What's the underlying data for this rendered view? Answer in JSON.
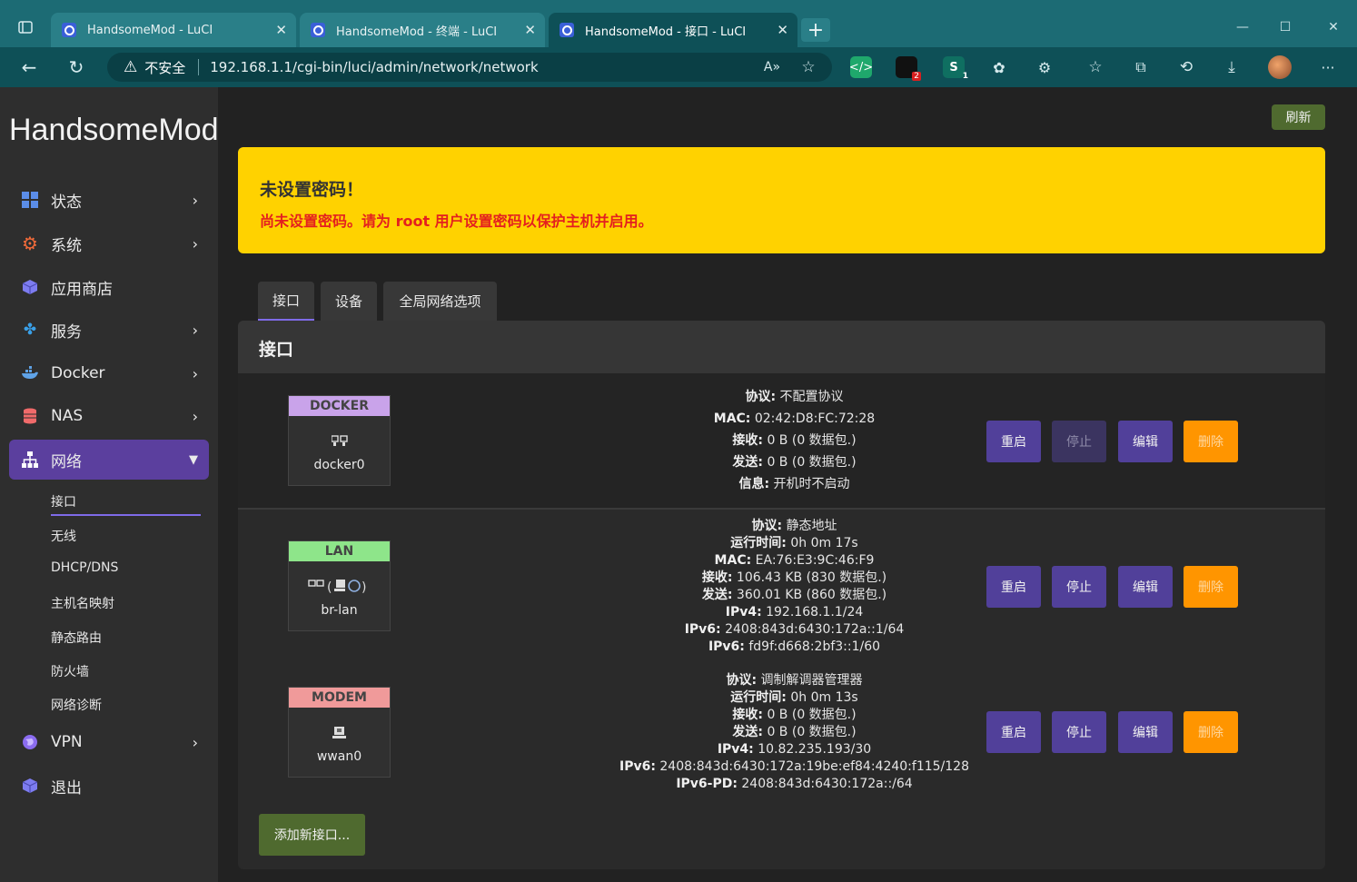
{
  "browser": {
    "tabs": [
      {
        "title": "HandsomeMod - LuCI"
      },
      {
        "title": "HandsomeMod - 终端 - LuCI"
      },
      {
        "title": "HandsomeMod - 接口 - LuCI"
      }
    ],
    "insecure_label": "不安全",
    "url": "192.168.1.1/cgi-bin/luci/admin/network/network",
    "ext_badge_1": "2",
    "ext_badge_2": "1",
    "accent": "#1c6b74"
  },
  "sidebar": {
    "brand": "HandsomeMod",
    "items": [
      {
        "label": "状态",
        "icon": "dashboard-icon"
      },
      {
        "label": "系统",
        "icon": "gear-icon"
      },
      {
        "label": "应用商店",
        "icon": "box-icon"
      },
      {
        "label": "服务",
        "icon": "puzzle-icon"
      },
      {
        "label": "Docker",
        "icon": "docker-icon"
      },
      {
        "label": "NAS",
        "icon": "database-icon"
      },
      {
        "label": "网络",
        "icon": "network-icon"
      },
      {
        "label": "VPN",
        "icon": "globe-icon"
      },
      {
        "label": "退出",
        "icon": "box-icon"
      }
    ],
    "sub_items": [
      "接口",
      "无线",
      "DHCP/DNS",
      "主机名映射",
      "静态路由",
      "防火墙",
      "网络诊断"
    ]
  },
  "main": {
    "refresh_label": "刷新",
    "alert": {
      "title": "未设置密码！",
      "text": "尚未设置密码。请为 root 用户设置密码以保护主机并启用。"
    },
    "tabs": [
      "接口",
      "设备",
      "全局网络选项"
    ],
    "panel_title": "接口",
    "actions": {
      "restart": "重启",
      "stop": "停止",
      "edit": "编辑",
      "delete": "删除"
    },
    "add_label": "添加新接口...",
    "interfaces": [
      {
        "name": "DOCKER",
        "color": "#c9a3ea",
        "device": "docker0",
        "icon": "ethernet-icon",
        "info": [
          {
            "k": "协议:",
            "v": " 不配置协议"
          },
          {
            "k": "MAC:",
            "v": " 02:42:D8:FC:72:28"
          },
          {
            "k": "接收:",
            "v": " 0 B (0 数据包.)"
          },
          {
            "k": "发送:",
            "v": " 0 B (0 数据包.)"
          },
          {
            "k": "信息:",
            "v": " 开机时不启动"
          }
        ]
      },
      {
        "name": "LAN",
        "color": "#8ee58a",
        "device": "br-lan",
        "icon": "bridge-icon",
        "info": [
          {
            "k": "协议:",
            "v": " 静态地址"
          },
          {
            "k": "运行时间:",
            "v": " 0h 0m 17s"
          },
          {
            "k": "MAC:",
            "v": " EA:76:E3:9C:46:F9"
          },
          {
            "k": "接收:",
            "v": " 106.43 KB (830 数据包.)"
          },
          {
            "k": "发送:",
            "v": " 360.01 KB (860 数据包.)"
          },
          {
            "k": "IPv4:",
            "v": " 192.168.1.1/24"
          },
          {
            "k": "IPv6:",
            "v": " 2408:843d:6430:172a::1/64"
          },
          {
            "k": "IPv6:",
            "v": " fd9f:d668:2bf3::1/60"
          }
        ]
      },
      {
        "name": "MODEM",
        "color": "#f09a9a",
        "device": "wwan0",
        "icon": "modem-icon",
        "info": [
          {
            "k": "协议:",
            "v": " 调制解调器管理器"
          },
          {
            "k": "运行时间:",
            "v": " 0h 0m 13s"
          },
          {
            "k": "接收:",
            "v": " 0 B (0 数据包.)"
          },
          {
            "k": "发送:",
            "v": " 0 B (0 数据包.)"
          },
          {
            "k": "IPv4:",
            "v": " 10.82.235.193/30"
          },
          {
            "k": "IPv6:",
            "v": " 2408:843d:6430:172a:19be:ef84:4240:f115/128"
          },
          {
            "k": "IPv6-PD:",
            "v": " 2408:843d:6430:172a::/64"
          }
        ]
      }
    ]
  }
}
